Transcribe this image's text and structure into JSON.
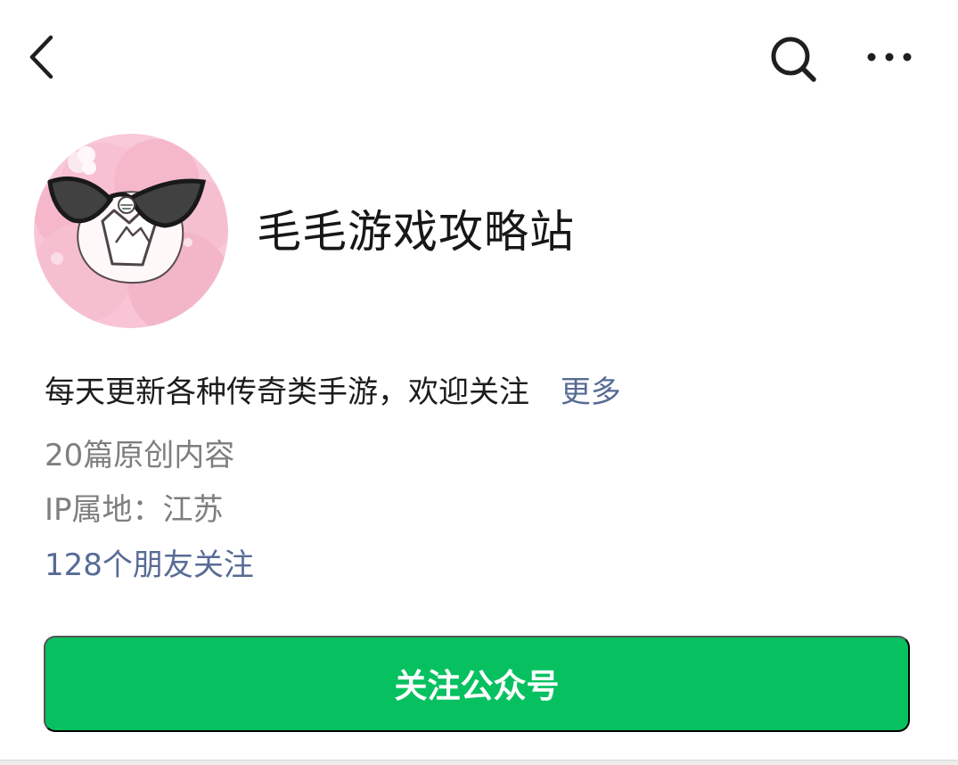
{
  "nav": {
    "back_icon": "chevron-left-icon",
    "search_icon": "search-icon",
    "more_icon": "ellipsis-icon"
  },
  "profile": {
    "name": "毛毛游戏攻略站",
    "avatar": "pink-hair-character-with-sunglasses",
    "intro": "每天更新各种传奇类手游，欢迎关注",
    "more_label": "更多",
    "original_count": "20篇原创内容",
    "ip_location": "IP属地：江苏",
    "friends_following": "128个朋友关注"
  },
  "actions": {
    "follow_label": "关注公众号"
  },
  "colors": {
    "primary_green": "#07c160",
    "link_blue": "#576b95",
    "secondary_gray": "#7e7e7e",
    "text_dark": "#171717"
  }
}
